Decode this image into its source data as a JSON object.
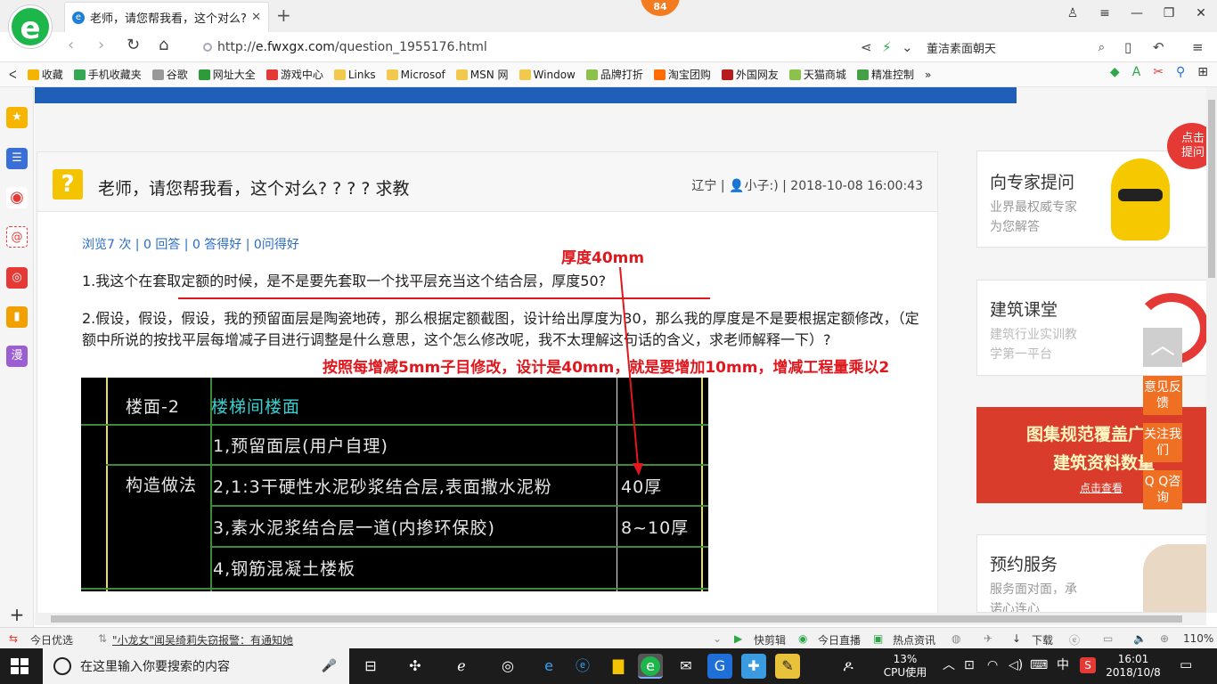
{
  "browser": {
    "tab_title": "老师，请您帮我看，这个对么? ? ? 求教",
    "notify_badge": "84",
    "url_prefix": "http://",
    "url_domain": "e.fwxgx.com",
    "url_path": "/question_1955176.html",
    "search_text": "董洁素面朝天",
    "bookmarks": [
      {
        "label": "收藏",
        "color": "#f5b400"
      },
      {
        "label": "手机收藏夹",
        "color": "#34a853"
      },
      {
        "label": "谷歌",
        "color": "#999999"
      },
      {
        "label": "网址大全",
        "color": "#2e9b3a"
      },
      {
        "label": "游戏中心",
        "color": "#e53935"
      },
      {
        "label": "Links",
        "color": "#f2c94c"
      },
      {
        "label": "Microsof",
        "color": "#f2c94c"
      },
      {
        "label": "MSN 网",
        "color": "#f2c94c"
      },
      {
        "label": "Window",
        "color": "#f2c94c"
      },
      {
        "label": "品牌打折",
        "color": "#8bc34a"
      },
      {
        "label": "淘宝团购",
        "color": "#ff6d00"
      },
      {
        "label": "外国网友",
        "color": "#b71c1c"
      },
      {
        "label": "天猫商城",
        "color": "#8bc34a"
      },
      {
        "label": "精准控制",
        "color": "#43a047"
      }
    ]
  },
  "question": {
    "title": "老师，请您帮我看，这个对么? ? ? ? 求教",
    "region": "辽宁",
    "user": "小子:)",
    "datetime": "2018-10-08 16:00:43",
    "stats": "浏览7 次 | 0 回答 | 0 答得好 | 0问得好",
    "para1": "1.我这个在套取定额的时候，是不是要先套取一个找平层充当这个结合层，厚度50?",
    "para2": "2.假设，假设，假设，我的预留面层是陶瓷地砖，那么根据定额截图，设计给出厚度为30，那么我的厚度是不是要根据定额修改，（定额中所说的按找平层每增减子目进行调整是什么意思，这个怎么修改呢，我不太理解这句话的含义，求老师解释一下）?"
  },
  "annotations": {
    "thickness": "厚度40mm",
    "explanation": "按照每增减5mm子目修改，设计是40mm，就是要增加10mm，增减工程量乘以2"
  },
  "cad_table": {
    "row1_name": "楼面-2",
    "row1_desc": "楼梯间楼面",
    "method_label": "构造做法",
    "layers": [
      {
        "text": "1,预留面层(用户自理)",
        "thick": ""
      },
      {
        "text": "2,1:3干硬性水泥砂浆结合层,表面撒水泥粉",
        "thick": "40厚"
      },
      {
        "text": "3,素水泥浆结合层一道(内掺环保胶)",
        "thick": "8~10厚"
      },
      {
        "text": "4,钢筋混凝土楼板",
        "thick": ""
      }
    ]
  },
  "ads": {
    "expert_title": "向专家提问",
    "expert_sub1": "业界最权威专家",
    "expert_sub2": "为您解答",
    "expert_bubble": "点击提问",
    "course_title": "建筑课堂",
    "course_sub1": "建筑行业实训教",
    "course_sub2": "学第一平台",
    "banner_line1": "图集规范覆盖广",
    "banner_line2": "建筑资料数量",
    "banner_link": "点击查看",
    "booking_title": "预约服务",
    "booking_sub1": "服务面对面，承",
    "booking_sub2": "诺心连心"
  },
  "float_buttons": {
    "feedback": "意见反馈",
    "follow": "关注我们",
    "qq": "Q Q咨询"
  },
  "statusbar": {
    "today_pick": "今日优选",
    "news": "\"小龙女\"闻吴绮莉失窃报警：有通知她",
    "clip": "快剪辑",
    "live": "今日直播",
    "hot": "热点资讯",
    "download": "下载",
    "zoom": "110%"
  },
  "taskbar": {
    "search_placeholder": "在这里输入你要搜索的内容",
    "cpu_percent": "13%",
    "cpu_label": "CPU使用",
    "ime": "中",
    "time": "16:01",
    "date": "2018/10/8"
  }
}
